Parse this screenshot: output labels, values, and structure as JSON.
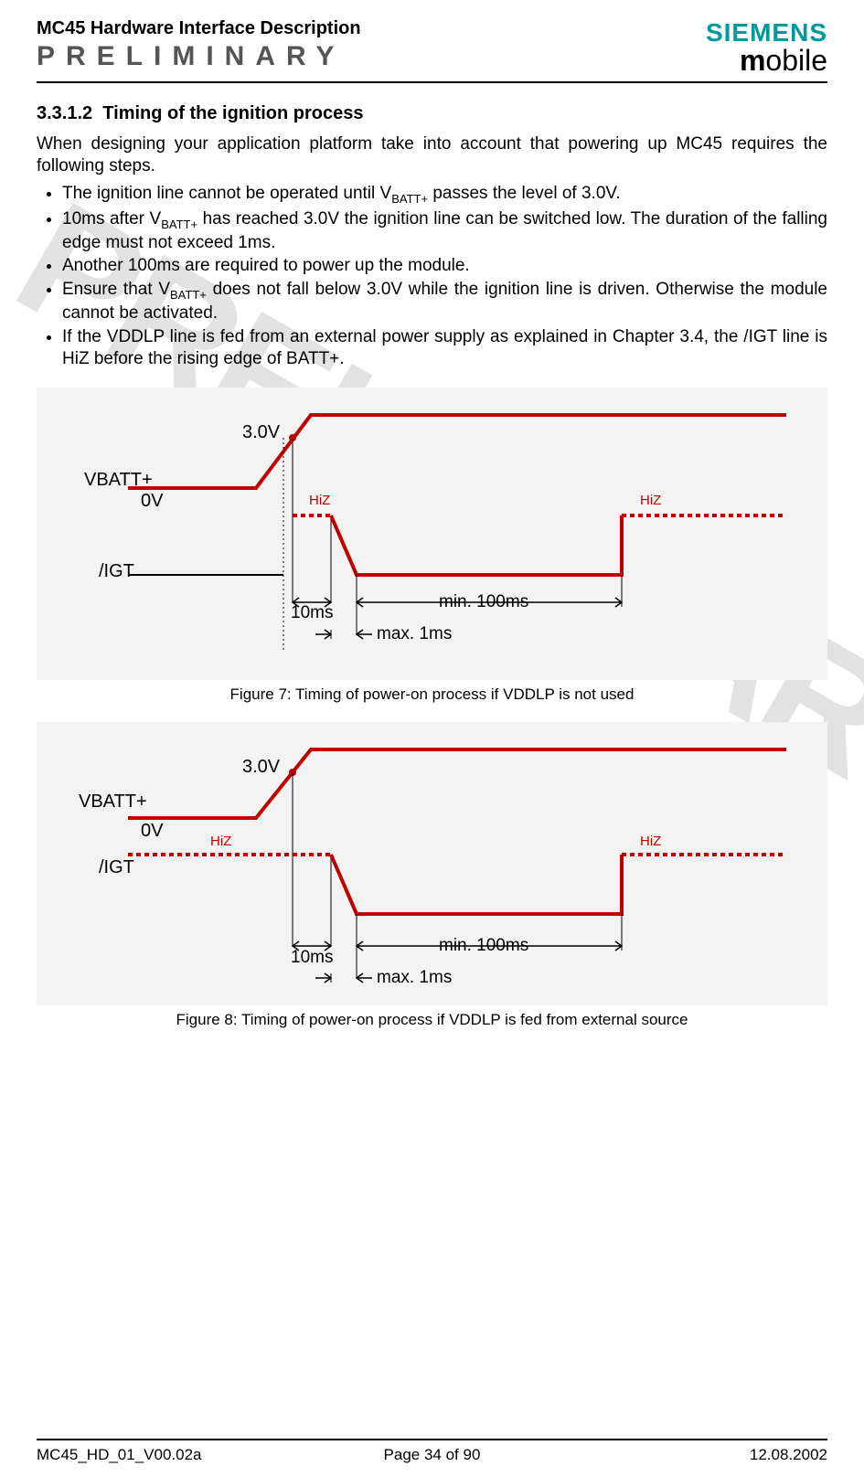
{
  "header": {
    "title": "MC45 Hardware Interface Description",
    "preliminary": "PRELIMINARY",
    "brand_top": "SIEMENS",
    "brand_bottom_m": "m",
    "brand_bottom_rest": "obile"
  },
  "watermark": "PRELIMINARY",
  "section": {
    "number": "3.3.1.2",
    "title": "Timing of the ignition process"
  },
  "intro": "When designing your application platform take into account that powering up MC45 requires the following steps.",
  "bullets": [
    "The ignition line cannot be operated until V<sub>BATT+</sub> passes the level of 3.0V.",
    "10ms after V<sub>BATT+</sub> has reached 3.0V the ignition line can be switched low. The duration of the falling edge must not exceed 1ms.",
    "Another 100ms are required to power up the module.",
    "Ensure that V<sub>BATT+</sub> does not fall below 3.0V while the ignition line is driven. Otherwise the module cannot be activated.",
    "If the VDDLP line is fed from an external power supply as explained in Chapter 3.4, the /IGT line is HiZ before the rising edge of BATT+."
  ],
  "fig7": {
    "vbatt": "VBATT+",
    "igt": "/IGT",
    "v3": "3.0V",
    "v0": "0V",
    "t10": "10ms",
    "t1": "max. 1ms",
    "t100": "min. 100ms",
    "hiz": "HiZ",
    "caption": "Figure 7: Timing of power-on process if VDDLP is not used"
  },
  "fig8": {
    "vbatt": "VBATT+",
    "igt": "/IGT",
    "v3": "3.0V",
    "v0": "0V",
    "t10": "10ms",
    "t1": "max. 1ms",
    "t100": "min. 100ms",
    "hiz": "HiZ",
    "caption": "Figure 8: Timing of power-on process if VDDLP is fed from external source"
  },
  "footer": {
    "left": "MC45_HD_01_V00.02a",
    "mid": "Page 34 of 90",
    "right": "12.08.2002"
  },
  "chart_data": [
    {
      "type": "timing-diagram",
      "title": "Timing of power-on process if VDDLP is not used",
      "signals": [
        {
          "name": "VBATT+",
          "segments": [
            {
              "state": "0V",
              "until": "t0"
            },
            {
              "state": "rising",
              "from": "t0",
              "to": "t_3.0V"
            },
            {
              "state": "high",
              "from": "t_3.0V"
            }
          ]
        },
        {
          "name": "/IGT",
          "segments": [
            {
              "state": "low",
              "until": "t_3.0V"
            },
            {
              "state": "HiZ",
              "from": "t_3.0V",
              "duration_ms": 10
            },
            {
              "state": "falling",
              "duration_ms_max": 1
            },
            {
              "state": "low",
              "duration_ms_min": 100
            },
            {
              "state": "HiZ"
            }
          ]
        }
      ],
      "annotations": {
        "threshold_V": 3.0,
        "delay_after_threshold_ms": 10,
        "fall_time_max_ms": 1,
        "low_hold_min_ms": 100
      }
    },
    {
      "type": "timing-diagram",
      "title": "Timing of power-on process if VDDLP is fed from external source",
      "signals": [
        {
          "name": "VBATT+",
          "segments": [
            {
              "state": "0V",
              "until": "t0"
            },
            {
              "state": "rising",
              "from": "t0",
              "to": "t_3.0V"
            },
            {
              "state": "high",
              "from": "t_3.0V"
            }
          ]
        },
        {
          "name": "/IGT",
          "segments": [
            {
              "state": "HiZ",
              "until": "t_3.0V+10ms"
            },
            {
              "state": "falling",
              "duration_ms_max": 1
            },
            {
              "state": "low",
              "duration_ms_min": 100
            },
            {
              "state": "HiZ"
            }
          ]
        }
      ],
      "annotations": {
        "threshold_V": 3.0,
        "delay_after_threshold_ms": 10,
        "fall_time_max_ms": 1,
        "low_hold_min_ms": 100
      }
    }
  ]
}
